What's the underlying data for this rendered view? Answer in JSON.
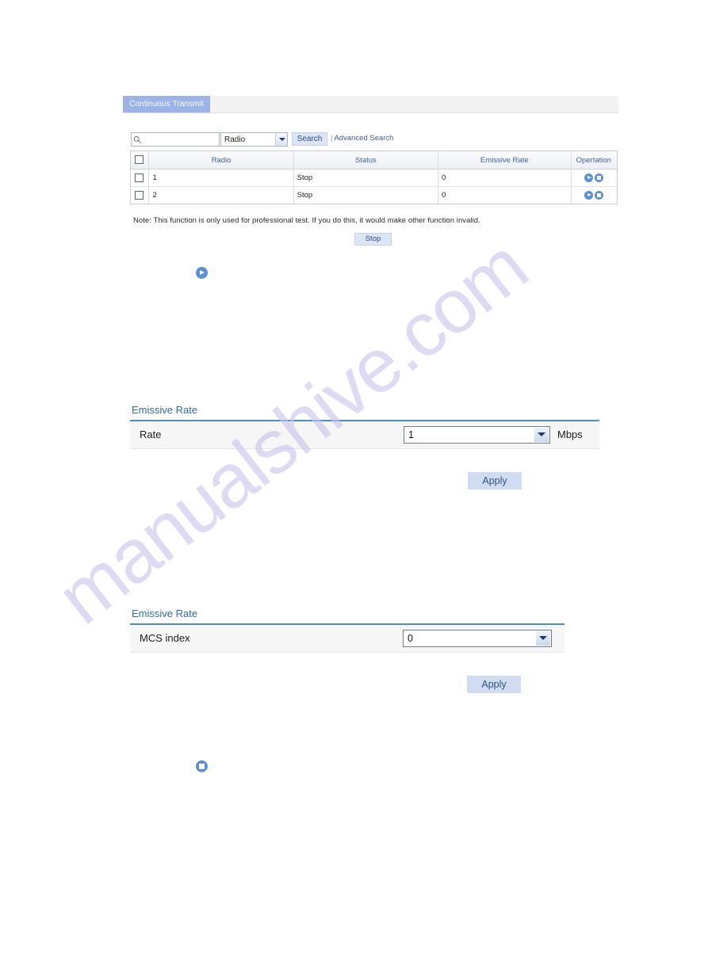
{
  "tab": {
    "label": "Continuous Transmit"
  },
  "search": {
    "input_value": "",
    "placeholder": "",
    "icon": "search-icon",
    "select_value": "Radio",
    "select_options": [
      "Radio"
    ],
    "button_label": "Search",
    "advanced_label": "Advanced Search",
    "separator": "|"
  },
  "table": {
    "columns": [
      "",
      "Radio",
      "Status",
      "Emissive Rate",
      "Opertation"
    ],
    "rows": [
      {
        "radio": "1",
        "status": "Stop",
        "emissive_rate": "0",
        "operations": [
          "play-icon",
          "stop-icon"
        ]
      },
      {
        "radio": "2",
        "status": "Stop",
        "emissive_rate": "0",
        "operations": [
          "play-icon",
          "stop-icon"
        ]
      }
    ]
  },
  "note": "Note: This function is only used for professional test. If you do this, it would make other function invalid.",
  "stop_button": {
    "label": "Stop"
  },
  "standalone_icons": [
    {
      "name": "play-icon",
      "color": "#5b90d6"
    },
    {
      "name": "stop-icon",
      "color": "#5b90d6"
    }
  ],
  "panel_rate": {
    "title": "Emissive Rate",
    "row_label": "Rate",
    "select_value": "1",
    "select_options": [
      "1"
    ],
    "unit": "Mbps",
    "apply_label": "Apply"
  },
  "panel_mcs": {
    "title": "Emissive Rate",
    "row_label": "MCS index",
    "select_value": "0",
    "select_options": [
      "0"
    ],
    "apply_label": "Apply"
  },
  "watermark": {
    "text": "manualshive.com"
  },
  "colors": {
    "tab_active_bg": "#9bb3e8",
    "accent_blue": "#4b8ec6",
    "header_text": "#3f63a8",
    "icon_blue": "#5b90d6",
    "button_bg": "#cfdcf1",
    "watermark": "#c9c4ec"
  }
}
